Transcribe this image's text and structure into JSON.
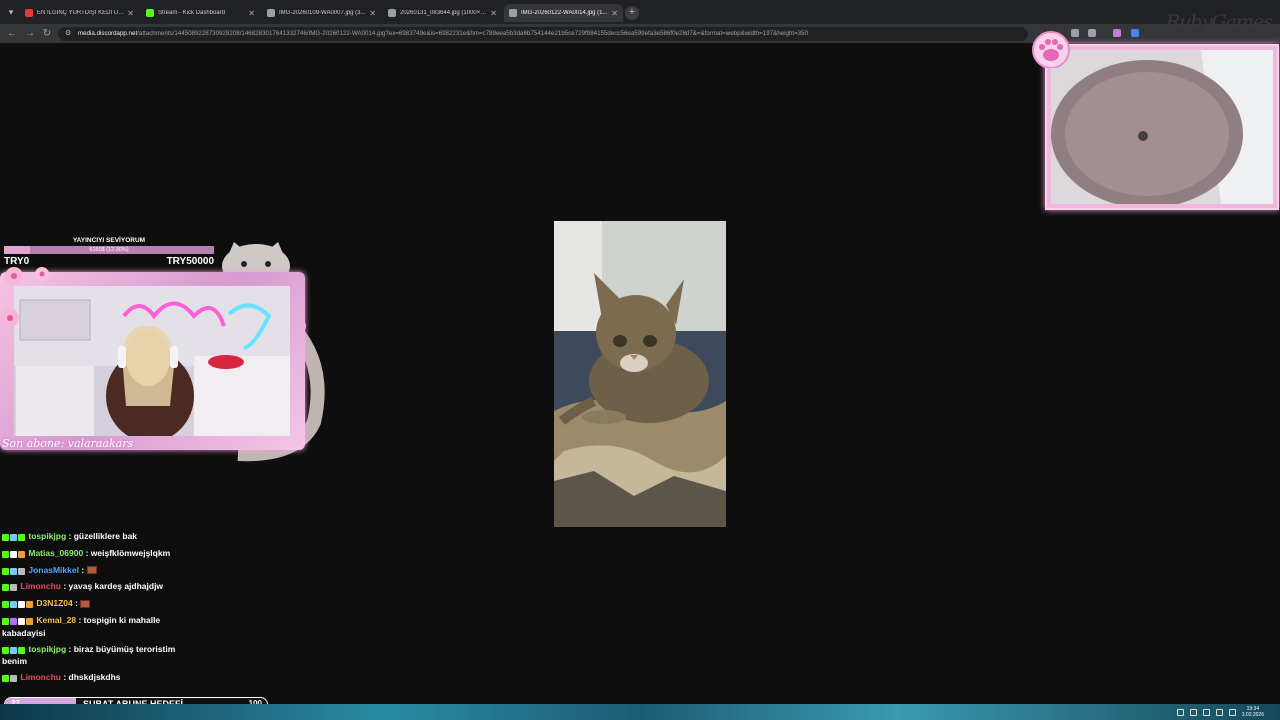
{
  "browser": {
    "tabs": [
      {
        "label": "EN İLGİNÇ YURTDIŞI KEDİ ÜRÜ",
        "favicon_color": "#e53935",
        "active": false
      },
      {
        "label": "Stream - Kick Dashboard",
        "favicon_color": "#53fc18",
        "active": false
      },
      {
        "label": "IMG-20260109-WA0007.jpg (3...",
        "favicon_color": "#9aa0a6",
        "active": false
      },
      {
        "label": "20260131_083644.jpg (1000×1...",
        "favicon_color": "#9aa0a6",
        "active": false
      },
      {
        "label": "IMG-20260122-WA0014.jpg (1...",
        "favicon_color": "#9aa0a6",
        "active": true
      }
    ],
    "url_host": "media.discordapp.net",
    "url_path": "/attachments/1445089228730929208/1468283017641332746/IMG-20260122-WA0014.jpg?ex=6983749e&is=6982231e&hm=c789eea5b3da6b754144e21b5ce729f984155decc56ea599efa3e586f0e28d7&=&format=webp&width=197&height=350"
  },
  "overlay": {
    "goal_title": "YAYINCIYI SEVİYORUM",
    "goal_progress_text": "6150$ (12.30%)",
    "goal_progress_fraction": 0.123,
    "goal_min": "TRY0",
    "goal_max": "TRY50000",
    "last_subscriber": "Son abone: valaraakars",
    "watermark": "RubyGames"
  },
  "chat": [
    {
      "user": "tospikjpg",
      "color": "#8fef6e",
      "message": "güzelliklere bak",
      "emote": false,
      "badges": [
        "#53fc18",
        "#7ac7ff",
        "#53fc18"
      ]
    },
    {
      "user": "Matias_06900",
      "color": "#8fef6e",
      "message": "weişfklömwejşlqkm",
      "emote": false,
      "badges": [
        "#53fc18",
        "#ffffff",
        "#f0a030"
      ]
    },
    {
      "user": "JonasMikkel",
      "color": "#5aa0ff",
      "message": "",
      "emote": true,
      "badges": [
        "#53fc18",
        "#7ac7ff",
        "#bbbbbb"
      ]
    },
    {
      "user": "Limonchu",
      "color": "#e74c5b",
      "message": "yavaş kardeş ajdhajdjw",
      "emote": false,
      "badges": [
        "#53fc18",
        "#bbbbbb"
      ]
    },
    {
      "user": "D3N1Z04",
      "color": "#f2c14e",
      "message": "",
      "emote": true,
      "badges": [
        "#53fc18",
        "#7ac7ff",
        "#ffffff",
        "#f0a030"
      ]
    },
    {
      "user": "Kemal_28",
      "color": "#f2c14e",
      "message": "tospigin ki mahalle kabadayisi",
      "emote": false,
      "badges": [
        "#53fc18",
        "#b070ff",
        "#ffffff",
        "#f0a030"
      ]
    },
    {
      "user": "tospikjpg",
      "color": "#8fef6e",
      "message": "biraz büyümüş teroristim benim",
      "emote": false,
      "badges": [
        "#53fc18",
        "#7ac7ff",
        "#53fc18"
      ]
    },
    {
      "user": "Limonchu",
      "color": "#e74c5b",
      "message": "dhskdjskdhs",
      "emote": false,
      "badges": [
        "#53fc18",
        "#bbbbbb"
      ]
    }
  ],
  "sub_goal": {
    "current": "27",
    "label": "ŞUBAT ABUNE HEDEFİ",
    "target": "100",
    "fraction": 0.27
  },
  "taskbar": {
    "time": "19:34",
    "date": "3.02.2026"
  }
}
